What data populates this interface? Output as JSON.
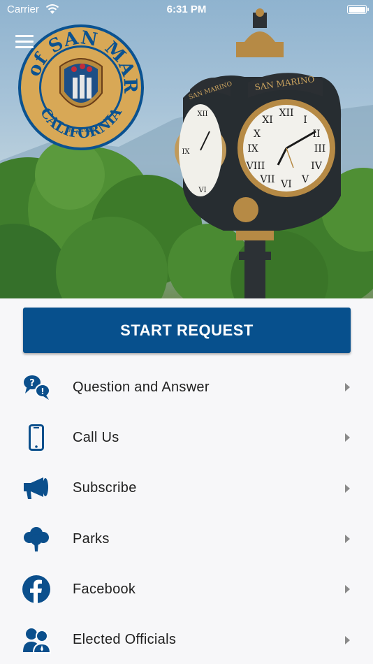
{
  "status_bar": {
    "carrier": "Carrier",
    "time": "6:31 PM"
  },
  "seal": {
    "top_text": "CITY of SAN MARINO",
    "bottom_text": "CALIFORNIA",
    "inc_text": "INC. 1913"
  },
  "clock_sign": {
    "left": "SAN MARINO",
    "right": "SAN MARINO"
  },
  "start_button": {
    "label": "START REQUEST"
  },
  "menu": [
    {
      "label": "Question and Answer",
      "icon": "question-answer-icon"
    },
    {
      "label": "Call Us",
      "icon": "phone-icon"
    },
    {
      "label": "Subscribe",
      "icon": "megaphone-icon"
    },
    {
      "label": "Parks",
      "icon": "tree-icon"
    },
    {
      "label": "Facebook",
      "icon": "facebook-icon"
    },
    {
      "label": "Elected Officials",
      "icon": "officials-icon"
    }
  ],
  "colors": {
    "primary": "#07508d",
    "seal_gold": "#d6a652",
    "icon_blue": "#0b4f8c"
  }
}
